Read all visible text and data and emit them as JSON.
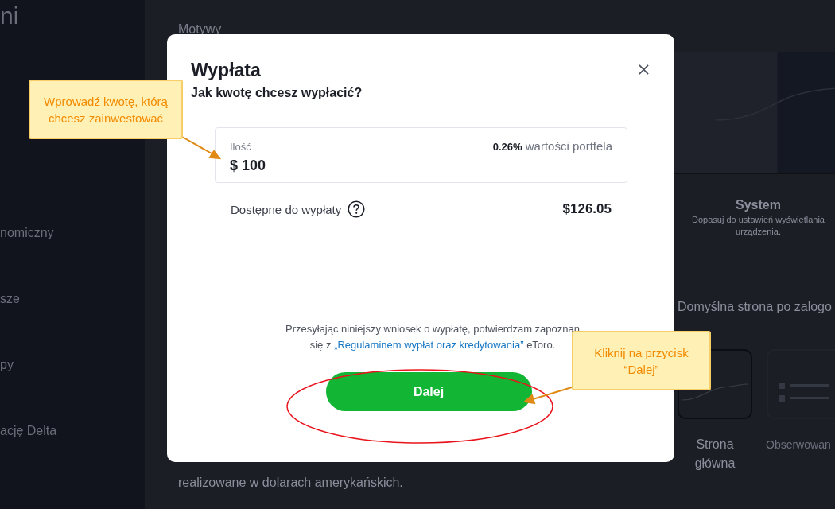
{
  "sidebar": {
    "title": "ni",
    "items": [
      "nomiczny",
      "sze",
      "py",
      "ację Delta"
    ]
  },
  "page": {
    "section_title": "Motywy",
    "theme_option": {
      "title": "System",
      "description_lines": [
        "Dopasuj do ustawień wyświetlania",
        "urządzenia."
      ]
    },
    "default_page": {
      "title": "Domyślna strona po zalogo",
      "options": [
        {
          "label": "Strona główna",
          "selected": true
        },
        {
          "label": "Obserwowan",
          "selected": false
        }
      ]
    },
    "note": "realizowane w dolarach amerykańskich."
  },
  "modal": {
    "title": "Wypłata",
    "subtitle": "Jak kwotę chcesz wypłacić?",
    "amount": {
      "label": "Ilość",
      "value": "$ 100",
      "share": "**0.26%** wartości portfela"
    },
    "available": {
      "label": "Dostępne do wypłaty",
      "value": "$126.05"
    },
    "consent": {
      "line_1": "Przesyłając niniejszy wniosek o wypłatę, potwierdzam zapoznan",
      "prefix": "się z ",
      "link": "„Regulaminem wypłat oraz kredytowania”",
      "suffix": " eToro."
    },
    "button": "Dalej"
  },
  "annotations": [
    {
      "kind": "callout",
      "text": "Wprowadź kwotę, którą chcesz zainwestować"
    },
    {
      "kind": "callout",
      "text": "Kliknij na przycisk “Dalej”"
    }
  ]
}
